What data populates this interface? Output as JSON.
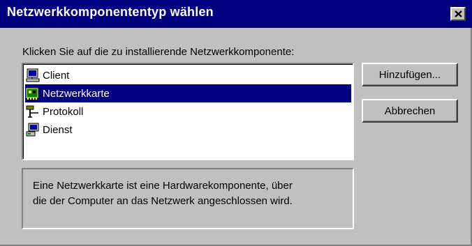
{
  "window": {
    "title": "Netzwerkkomponententyp wählen",
    "close_symbol": "×"
  },
  "instruction": "Klicken Sie auf die zu installierende Netzwerkkomponente:",
  "list": {
    "items": [
      {
        "label": "Client",
        "icon": "client-computer-icon",
        "selected": false
      },
      {
        "label": "Netzwerkkarte",
        "icon": "network-card-icon",
        "selected": true
      },
      {
        "label": "Protokoll",
        "icon": "protocol-connector-icon",
        "selected": false
      },
      {
        "label": "Dienst",
        "icon": "service-computer-icon",
        "selected": false
      }
    ]
  },
  "buttons": {
    "add_label": "Hinzufügen...",
    "cancel_label": "Abbrechen"
  },
  "description": {
    "line1": "Eine Netzwerkkarte ist eine Hardwarekomponente, über",
    "line2": "die der Computer an das Netzwerk angeschlossen wird."
  },
  "colors": {
    "titlebar": "#000080",
    "face": "#c0c0c0",
    "selection": "#000080"
  }
}
